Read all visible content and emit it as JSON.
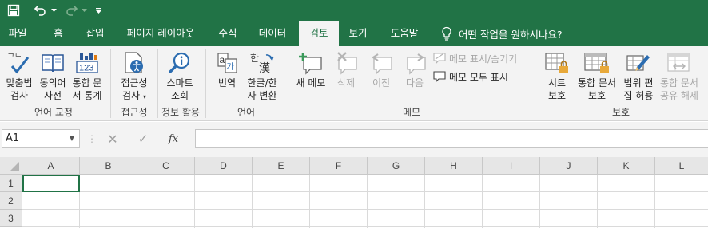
{
  "tabs": [
    {
      "label": "파일"
    },
    {
      "label": "홈"
    },
    {
      "label": "삽입"
    },
    {
      "label": "페이지 레이아웃"
    },
    {
      "label": "수식"
    },
    {
      "label": "데이터"
    },
    {
      "label": "검토"
    },
    {
      "label": "보기"
    },
    {
      "label": "도움말"
    }
  ],
  "tell_me": {
    "text": "어떤 작업을 원하시나요?"
  },
  "ribbon": {
    "proofing": {
      "spell_1": "맞춤법",
      "spell_2": "검사",
      "thes_1": "동의어",
      "thes_2": "사전",
      "stats_1": "통합 문",
      "stats_2": "서 통계",
      "label": "언어 교정"
    },
    "accessibility": {
      "line_1": "접근성",
      "line_2": "검사",
      "label": "접근성"
    },
    "insights": {
      "line_1": "스마트",
      "line_2": "조회",
      "label": "정보 활용"
    },
    "language": {
      "translate": "번역",
      "hanja_1": "한글/한",
      "hanja_2": "자 변환",
      "label": "언어"
    },
    "comments": {
      "new": "새 메모",
      "delete": "삭제",
      "prev": "이전",
      "next": "다음",
      "show_hide": "메모 표시/숨기기",
      "show_all": "메모 모두 표시",
      "label": "메모"
    },
    "protect": {
      "sheet_1": "시트",
      "sheet_2": "보호",
      "wb_1": "통합 문서",
      "wb_2": "보호",
      "range_1": "범위 편",
      "range_2": "집 허용",
      "unshare_1": "통합 문서",
      "unshare_2": "공유 해제",
      "label": "보호"
    }
  },
  "formula_bar": {
    "name_box": "A1",
    "fx": "fx",
    "value": ""
  },
  "grid": {
    "columns": [
      "A",
      "B",
      "C",
      "D",
      "E",
      "F",
      "G",
      "H",
      "I",
      "J",
      "K",
      "L"
    ],
    "rows": [
      "1",
      "2",
      "3"
    ]
  }
}
